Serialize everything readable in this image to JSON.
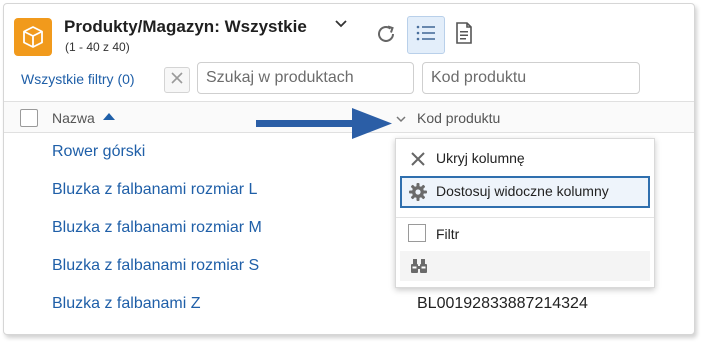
{
  "header": {
    "title": "Produkty/Magazyn: Wszystkie",
    "subtitle": "(1 - 40 z 40)"
  },
  "icons": {
    "app": "box-icon",
    "title_menu": "chevron-down-icon",
    "refresh": "refresh-icon",
    "list_view": "list-icon",
    "document_view": "document-icon",
    "clear": "close-icon",
    "sort": "sort-ascending-icon",
    "column_menu": "chevron-down-icon"
  },
  "filters": {
    "all_filters_label": "Wszystkie filtry (0)",
    "search_placeholder": "Szukaj w produktach",
    "code_placeholder": "Kod produktu"
  },
  "table": {
    "columns": [
      "Nazwa",
      "Kod produktu"
    ],
    "rows": [
      {
        "name": "Rower górski",
        "code": ""
      },
      {
        "name": "Bluzka z falbanami rozmiar L",
        "code": ""
      },
      {
        "name": "Bluzka z falbanami rozmiar M",
        "code": ""
      },
      {
        "name": "Bluzka z falbanami rozmiar S",
        "code": ""
      },
      {
        "name": "Bluzka z falbanami Z",
        "code": "BL00192833887214324"
      }
    ]
  },
  "column_menu": {
    "items": [
      {
        "label": "Ukryj kolumnę",
        "icon": "close-icon"
      },
      {
        "label": "Dostosuj widoczne kolumny",
        "icon": "gear-icon",
        "highlighted": true
      },
      {
        "label": "Filtr",
        "icon": "checkbox-icon"
      }
    ],
    "sub_icon": "binoculars-icon"
  },
  "colors": {
    "accent": "#1f5fa8",
    "app_icon": "#f19a1c",
    "arrow": "#2b5ea6"
  }
}
